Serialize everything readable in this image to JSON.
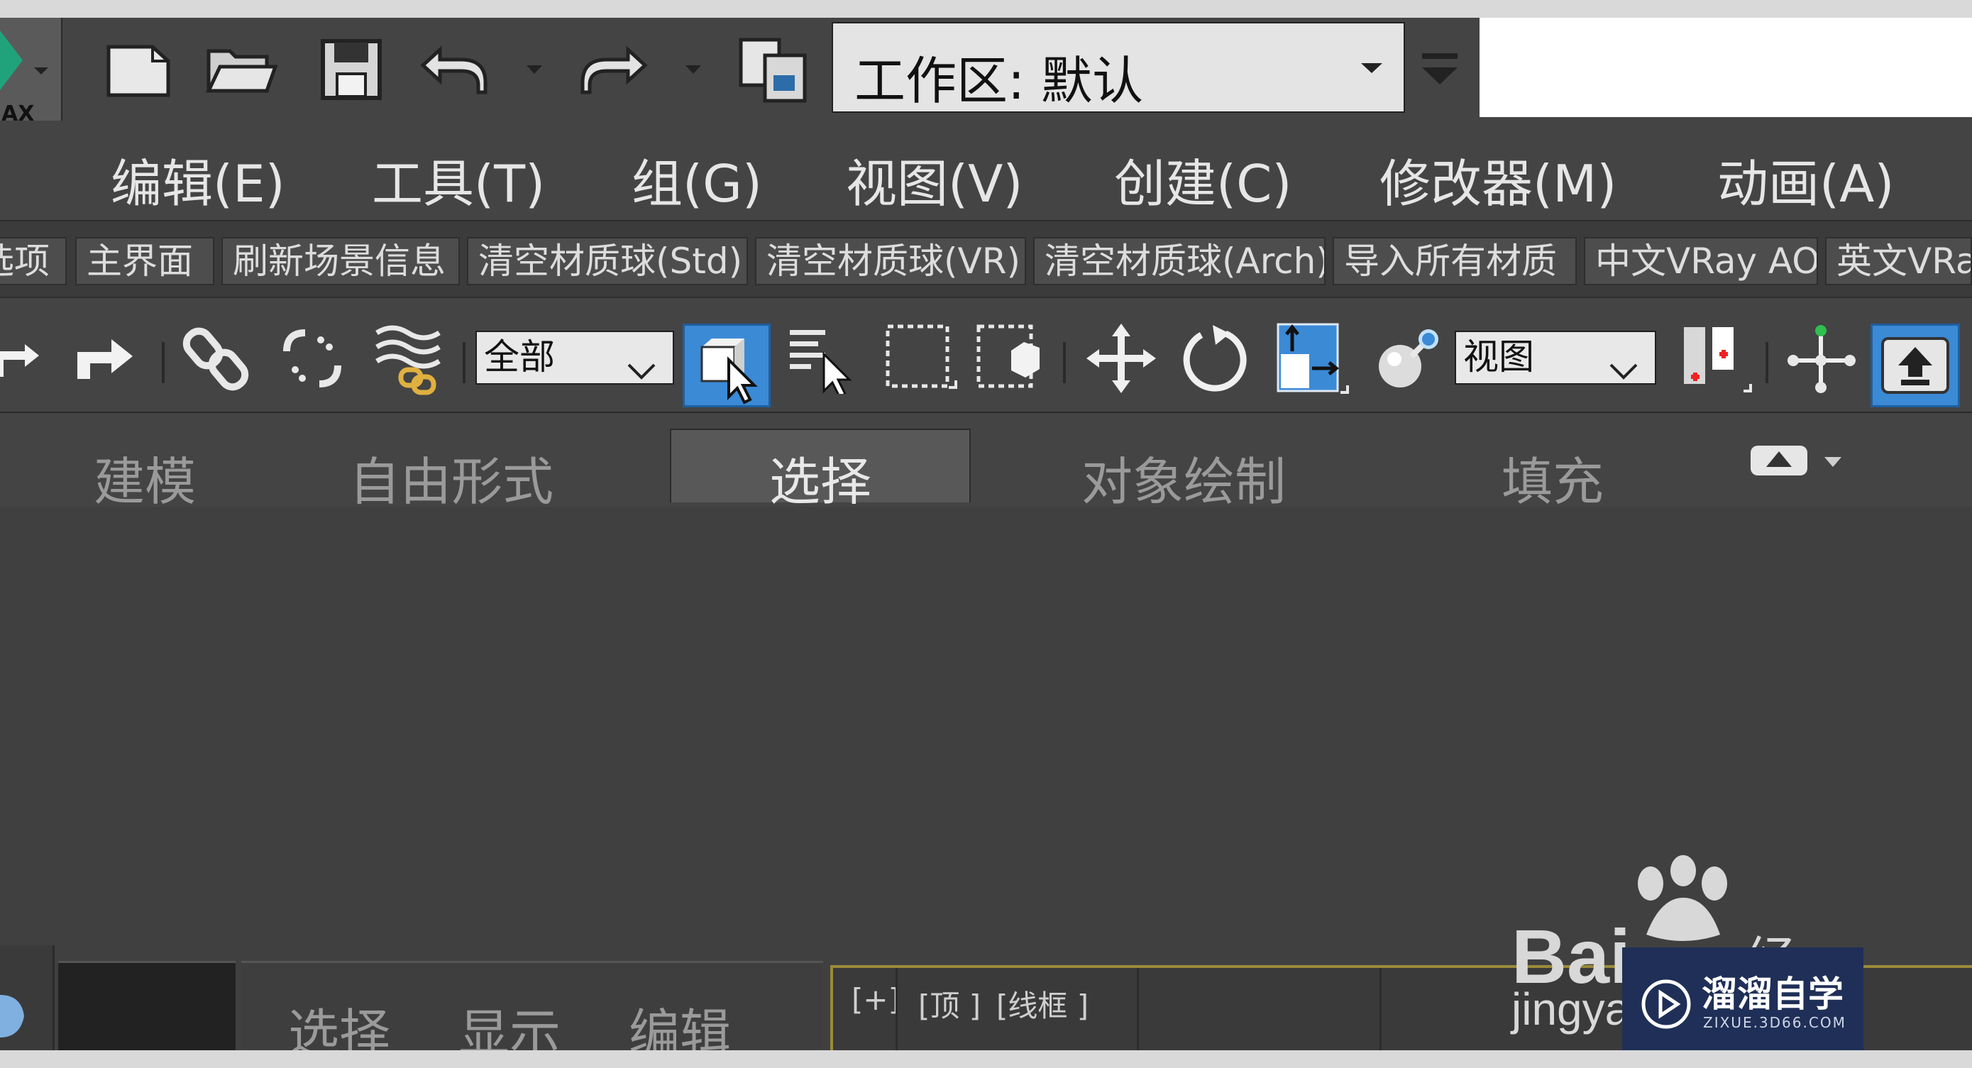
{
  "app": {
    "logo_label": "AX"
  },
  "quick_access": {
    "icons": [
      "new-file-icon",
      "open-folder-icon",
      "save-icon",
      "undo-icon",
      "redo-icon",
      "project-folder-icon"
    ],
    "workspace_label": "工作区: 默认"
  },
  "menu": {
    "items": [
      "编辑(E)",
      "工具(T)",
      "组(G)",
      "视图(V)",
      "创建(C)",
      "修改器(M)",
      "动画(A)"
    ]
  },
  "custom_toolbar": {
    "buttons": [
      "选项",
      "主界面",
      "刷新场景信息",
      "清空材质球(Std)",
      "清空材质球(VR)",
      "清空材质球(Arch)",
      "导入所有材质",
      "中文VRay AO",
      "英文VRay"
    ]
  },
  "main_toolbar": {
    "selection_filter": "全部",
    "reference_coord": "视图"
  },
  "ribbon": {
    "tabs": [
      "建模",
      "自由形式",
      "选择",
      "对象绘制",
      "填充"
    ],
    "active_tab": "选择"
  },
  "bottom_panel": {
    "tabs": [
      "选择",
      "显示",
      "编辑"
    ]
  },
  "viewport": {
    "labels": [
      "[+]",
      "[顶 ]",
      "[线框 ]"
    ]
  },
  "watermarks": {
    "baidu_text": "Bai",
    "baidu_sub": "jingya",
    "baidu_jy": "经验",
    "zixue_title": "溜溜自学",
    "zixue_url": "ZIXUE.3D66.COM"
  },
  "colors": {
    "accent": "#3b8ad6",
    "viewport_border": "#9a8a3a",
    "watermark_bg": "#1f2f57"
  }
}
